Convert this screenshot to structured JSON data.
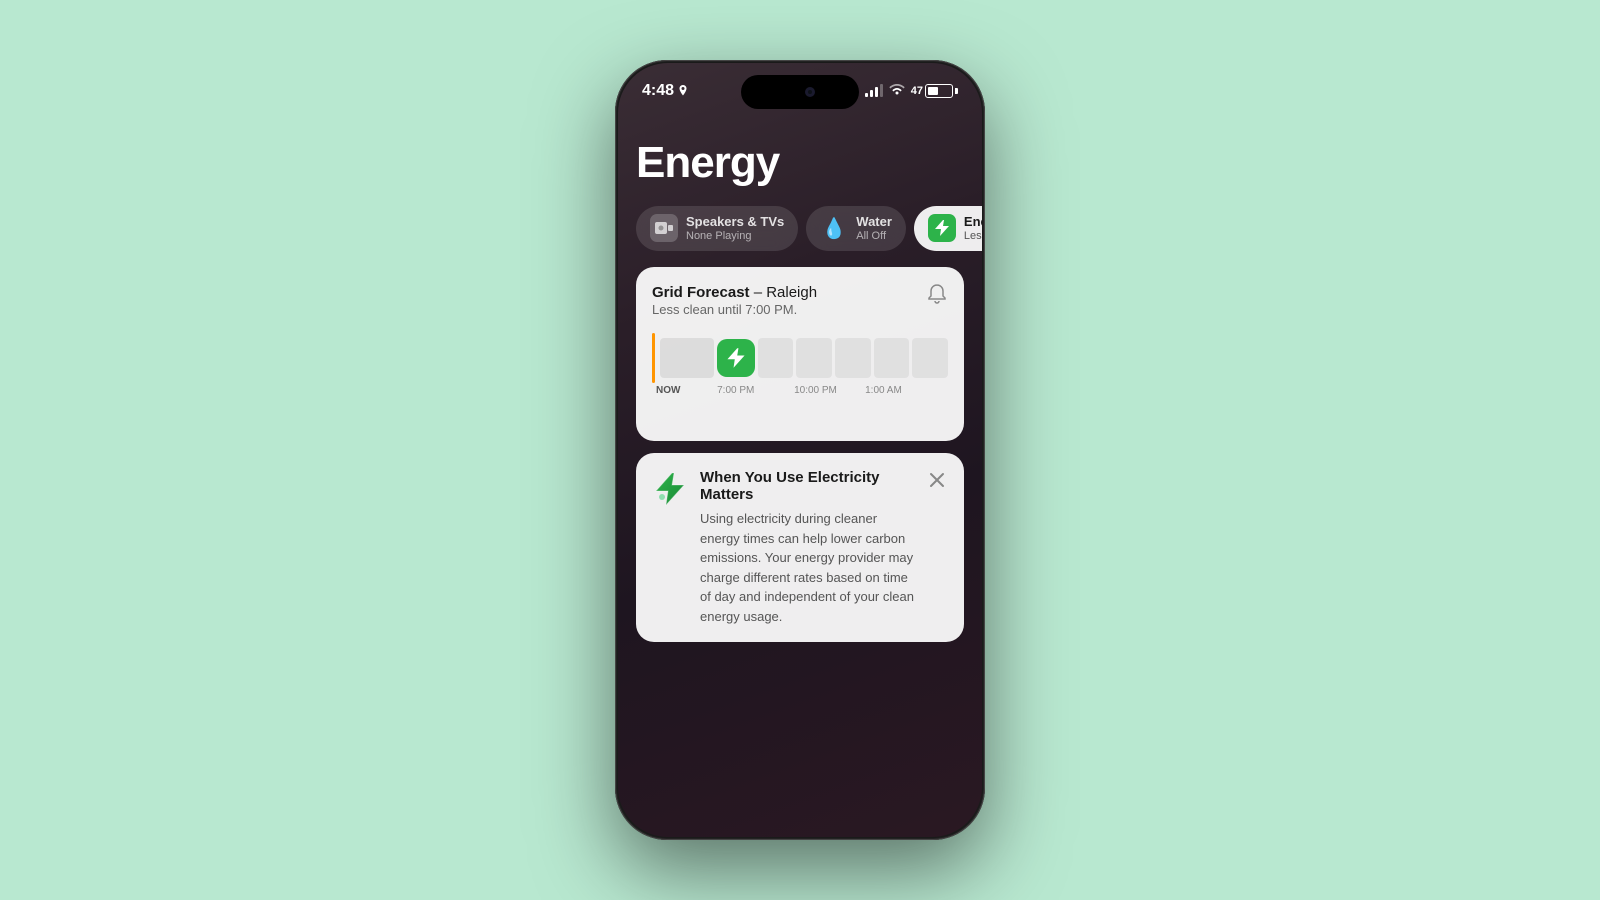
{
  "background_color": "#b8e8d0",
  "phone": {
    "status_bar": {
      "time": "4:48",
      "battery_percent": "47"
    },
    "page_title": "Energy",
    "pills": [
      {
        "id": "speakers",
        "icon": "🔊",
        "title": "Speakers & TVs",
        "subtitle": "None Playing",
        "active": false
      },
      {
        "id": "water",
        "icon": "💧",
        "title": "Water",
        "subtitle": "All Off",
        "active": false
      },
      {
        "id": "energy",
        "icon": "⚡",
        "title": "Energy",
        "subtitle": "Less Clean",
        "active": true
      }
    ],
    "grid_forecast": {
      "title_bold": "Grid Forecast",
      "title_rest": " – Raleigh",
      "subtitle": "Less clean until 7:00 PM.",
      "timeline_labels": [
        "NOW",
        "7:00 PM",
        "10:00 PM",
        "1:00 AM"
      ]
    },
    "info_card": {
      "title": "When You Use Electricity Matters",
      "body": "Using electricity during cleaner energy times can help lower carbon emissions. Your energy provider may charge different rates based on time of day and independent of your clean energy usage."
    }
  }
}
